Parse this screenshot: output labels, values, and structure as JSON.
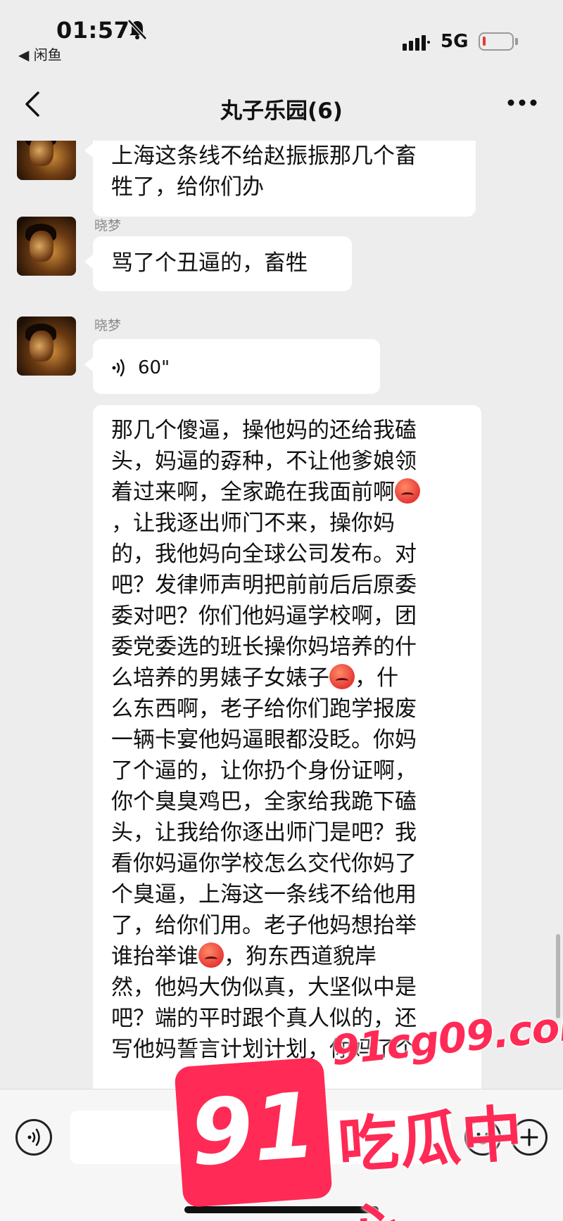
{
  "status_bar": {
    "time": "01:57",
    "back_app": "◀ 闲鱼",
    "network": "5G",
    "battery_level": 0.1
  },
  "nav": {
    "title": "丸子乐园(6)"
  },
  "messages": [
    {
      "sender": "",
      "type": "text",
      "lines": [
        "上海这条线不给赵振振那几个畜",
        "牲了，给你们办"
      ]
    },
    {
      "sender": "晓梦",
      "type": "text",
      "lines": [
        "骂了个丑逼的，畜牲"
      ]
    },
    {
      "sender": "晓梦",
      "type": "voice",
      "duration": "60\""
    },
    {
      "sender": "",
      "type": "text",
      "lines": [
        "那几个傻逼，操他妈的还给我磕",
        "头，妈逼的孬种，不让他爹娘领",
        "着过来啊，全家跪在我面前啊",
        "，让我逐出师门不来，操你妈",
        "的，我他妈向全球公司发布。对",
        "吧？发律师声明把前前后后原委",
        "委对吧？你们他妈逼学校啊，团",
        "委党委选的班长操你妈培养的什",
        "么培养的男婊子女婊子",
        "，什",
        "么东西啊，老子给你们跑学报废",
        "一辆卡宴他妈逼眼都没眨。你妈",
        "了个逼的，让你扔个身份证啊，",
        "你个臭臭鸡巴，全家给我跪下磕",
        "头，让我给你逐出师门是吧？我",
        "看你妈逼你学校怎么交代你妈了",
        "个臭逼，上海这一条线不给他用",
        "了，给你们用。老子他妈想抬举",
        "谁抬举谁",
        "，狗东西道貌岸",
        "然，他妈大伪似真，大坚似中是",
        "吧？端的平时跟个真人似的，还",
        "写他妈誓言计划计划，你妈了个"
      ]
    }
  ],
  "watermark": {
    "url": "91cg09.com",
    "number": "91",
    "text": "吃瓜中心"
  },
  "icons": [
    "back-arrow-icon",
    "more-icon",
    "voice-icon",
    "emoji-icon",
    "plus-icon",
    "mute-bell-icon"
  ]
}
